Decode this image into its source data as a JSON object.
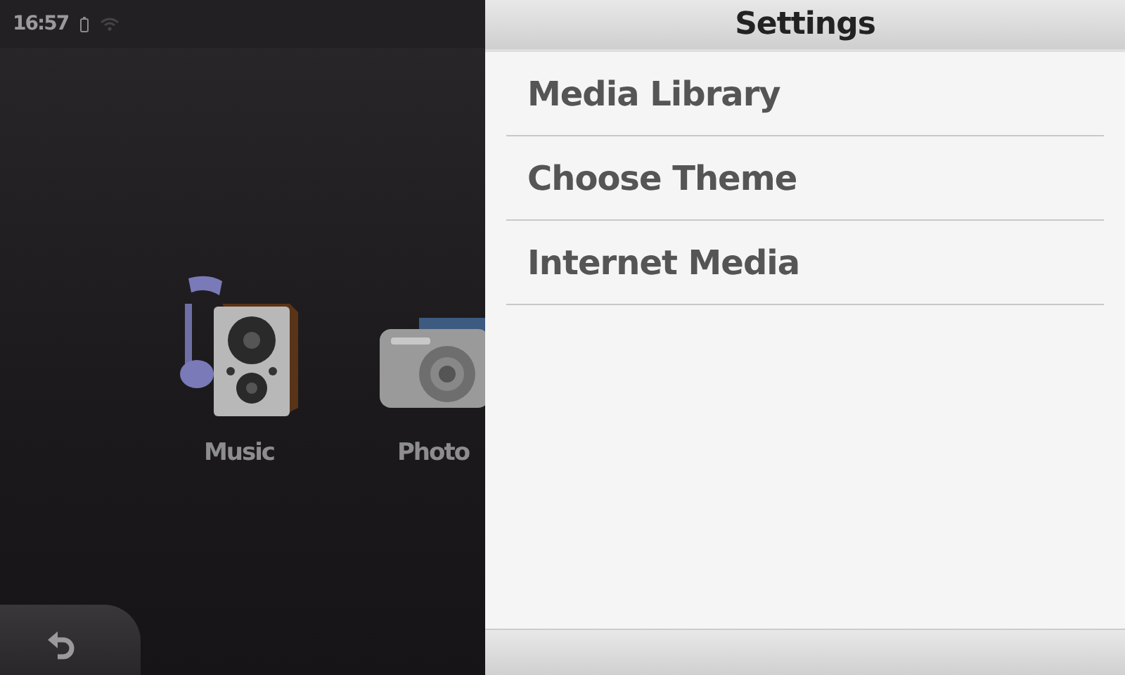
{
  "status_bar": {
    "time": "16:57"
  },
  "home": {
    "items": [
      {
        "kind": "music",
        "label": "Music"
      },
      {
        "kind": "photo",
        "label": "Photo"
      }
    ]
  },
  "settings": {
    "title": "Settings",
    "items": [
      {
        "label": "Media Library"
      },
      {
        "label": "Choose Theme"
      },
      {
        "label": "Internet Media"
      }
    ]
  }
}
